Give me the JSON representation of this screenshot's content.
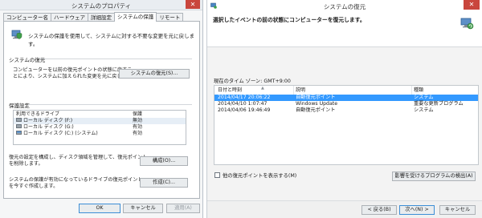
{
  "left_window": {
    "title": "システムのプロパティ",
    "tabs": [
      "コンピューター名",
      "ハードウェア",
      "詳細設定",
      "システムの保護",
      "リモート"
    ],
    "intro": "システムの保護を使用して、システムに対する不要な変更を元に戻します。",
    "restore_section": {
      "title": "システムの復元",
      "text_line1": "コンピューターを以前の復元ポイントの状態に戻すこ",
      "text_line2": "とにより、システムに加えられた変更を元に戻します。",
      "button": "システムの復元(S)..."
    },
    "protection_section": {
      "title": "保護設定",
      "col_drive": "利用できるドライブ",
      "col_protection": "保護",
      "drives": [
        {
          "name": "ローカル ディスク (F:)",
          "status": "無効"
        },
        {
          "name": "ローカル ディスク (G:)",
          "status": "有効"
        },
        {
          "name": "ローカル ディスク (C:) (システム)",
          "status": "有効"
        }
      ]
    },
    "config": {
      "text_line1": "復元の設定を構成し、ディスク領域を管理して、復元ポイント",
      "text_line2": "を削除します。",
      "button": "構成(O)..."
    },
    "create": {
      "text_line1": "システムの保護が有効になっているドライブの復元ポイント",
      "text_line2": "を今すぐ作成します。",
      "button": "作成(C)..."
    },
    "footer": {
      "ok": "OK",
      "cancel": "キャンセル",
      "apply": "適用(A)"
    }
  },
  "right_window": {
    "title": "システムの復元",
    "close": "✕",
    "header": "選択したイベントの前の状態にコンピューターを復元します。",
    "timezone": "現在のタイム ゾーン: GMT+9:00",
    "columns": [
      "日付と時刻",
      "説明",
      "種類"
    ],
    "rows": [
      {
        "date": "2014/04/17 20:06:22",
        "desc": "自動復元ポイント",
        "type": "システム",
        "selected": true
      },
      {
        "date": "2014/04/10 1:07:47",
        "desc": "Windows Update",
        "type": "重要な更新プログラム",
        "selected": false
      },
      {
        "date": "2014/04/06 19:46:49",
        "desc": "自動復元ポイント",
        "type": "システム",
        "selected": false
      }
    ],
    "show_more": "他の復元ポイントを表示する(M)",
    "scan_button": "影響を受けるプログラムの検出(A)",
    "footer": {
      "back": "< 戻る(B)",
      "next": "次へ(N) >",
      "cancel": "キャンセル"
    }
  },
  "colors": {
    "selected_row": "#3399ff",
    "close_button": "#c9463d",
    "primary_border": "#3c8ed6"
  }
}
